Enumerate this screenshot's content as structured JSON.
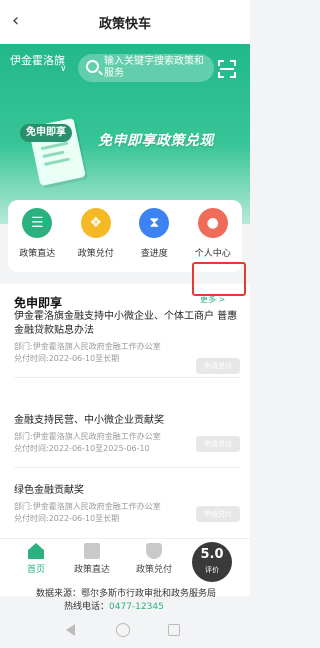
{
  "header": {
    "title": "政策快车"
  },
  "region": {
    "name": "伊金霍洛旗"
  },
  "search": {
    "placeholder": "输入关键字搜索政策和服务"
  },
  "banner": {
    "tag": "免申即享",
    "slogan": "免申即享政策兑现"
  },
  "quick_entries": [
    {
      "label": "政策直达",
      "icon": "policy-direct-icon",
      "color": "#2bb07f"
    },
    {
      "label": "政策兑付",
      "icon": "policy-redeem-icon",
      "color": "#f4b925"
    },
    {
      "label": "查进度",
      "icon": "progress-icon",
      "color": "#3c82f0"
    },
    {
      "label": "个人中心",
      "icon": "user-icon",
      "color": "#ef6b5a"
    }
  ],
  "section": {
    "title": "免申即享",
    "more": "更多 >"
  },
  "items": [
    {
      "title": "伊金霍洛旗金融支持中小微企业、个体工商户 普惠金融贷款贴息办法",
      "dept": "部门:伊金霍洛旗人民政府金融工作办公室",
      "period": "兑付时间:2022-06-10至长期",
      "action": "申请兑付"
    },
    {
      "title": "金融支持民营、中小微企业贡献奖",
      "dept": "部门:伊金霍洛旗人民政府金融工作办公室",
      "period": "兑付时间:2022-06-10至2025-06-10",
      "action": "申请兑付"
    },
    {
      "title": "绿色金融贡献奖",
      "dept": "部门:伊金霍洛旗人民政府金融工作办公室",
      "period": "兑付时间:2022-06-10至长期",
      "action": "申请兑付"
    }
  ],
  "tabs": [
    {
      "label": "首页",
      "active": true
    },
    {
      "label": "政策直达",
      "active": false
    },
    {
      "label": "政策兑付",
      "active": false
    }
  ],
  "rating": {
    "value": "5.0",
    "label": "评价"
  },
  "footer": {
    "source": "数据来源：鄂尔多斯市行政审批和政务服务局",
    "tel_label": "热线电话：",
    "tel": "0477-12345"
  },
  "colors": {
    "brand": "#2bb07f",
    "highlight": "#e53935"
  }
}
